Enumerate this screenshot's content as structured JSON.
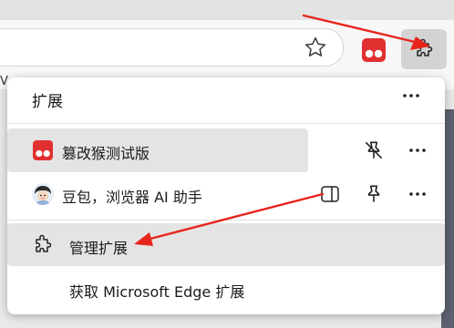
{
  "browser": {
    "favorites_partial": "V",
    "star_icon": "star-icon",
    "extensions_icon": "puzzle-icon"
  },
  "popup": {
    "title": "扩展",
    "more_icon": "more-icon",
    "items": [
      {
        "label": "篡改猴测试版",
        "icon": "tampermonkey-icon",
        "selected": true
      },
      {
        "label": "豆包，浏览器 AI 助手",
        "icon": "doubao-avatar"
      }
    ],
    "manage_label": "管理扩展",
    "get_label": "获取 Microsoft Edge 扩展"
  },
  "colors": {
    "accent_red": "#e8251c",
    "tampermonkey_red": "#e03030"
  }
}
